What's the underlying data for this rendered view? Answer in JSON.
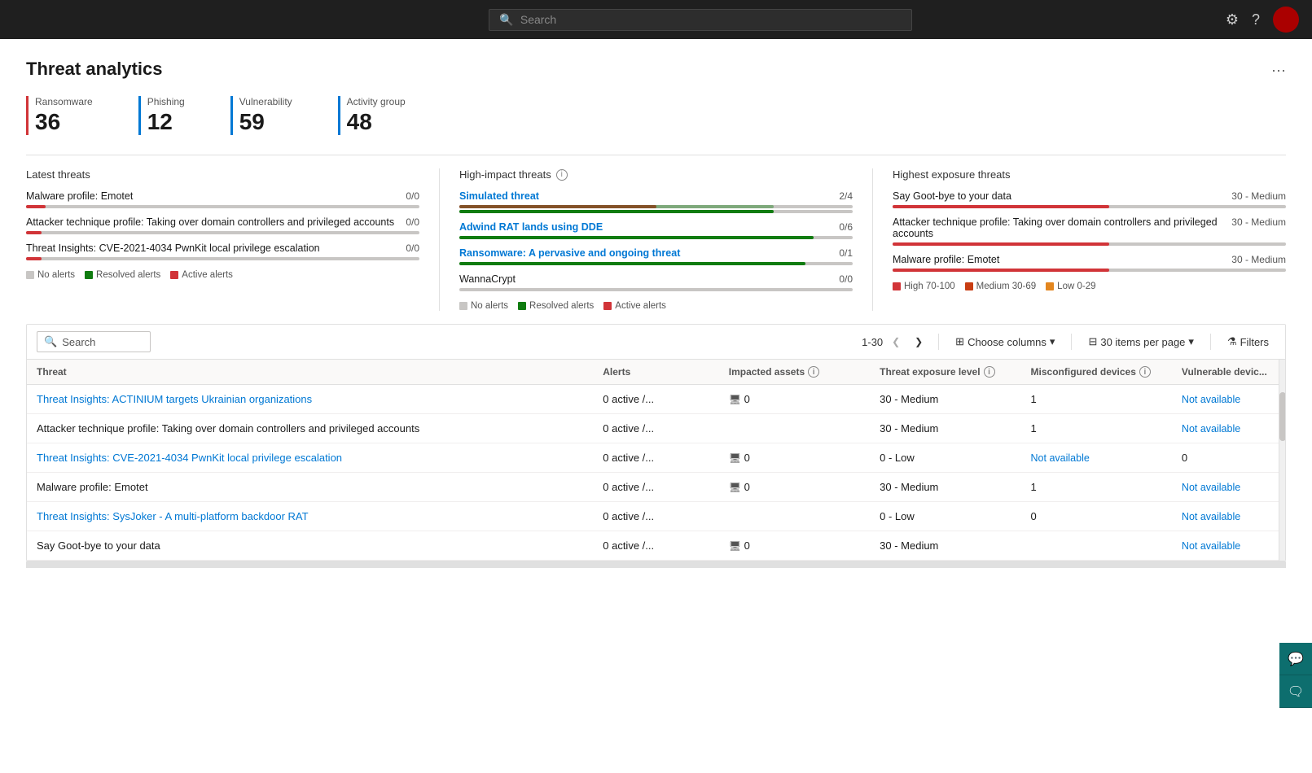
{
  "topbar": {
    "search_placeholder": "Search",
    "settings_icon": "⚙",
    "help_icon": "?"
  },
  "page": {
    "title": "Threat analytics"
  },
  "stats": [
    {
      "id": "ransomware",
      "label": "Ransomware",
      "value": "36",
      "color": "red"
    },
    {
      "id": "phishing",
      "label": "Phishing",
      "value": "12",
      "color": "blue"
    },
    {
      "id": "vulnerability",
      "label": "Vulnerability",
      "value": "59",
      "color": "blue2"
    },
    {
      "id": "activity",
      "label": "Activity group",
      "value": "48",
      "color": "blue3"
    }
  ],
  "latest_threats": {
    "title": "Latest threats",
    "items": [
      {
        "name": "Malware profile: Emotet",
        "score": "0/0",
        "red_pct": 5,
        "green_pct": 0
      },
      {
        "name": "Attacker technique profile: Taking over domain controllers and privileged accounts",
        "score": "0/0",
        "red_pct": 4,
        "green_pct": 0
      },
      {
        "name": "Threat Insights: CVE-2021-4034 PwnKit local privilege escalation",
        "score": "0/0",
        "red_pct": 4,
        "green_pct": 0
      }
    ],
    "legend": [
      {
        "color": "#c8c6c4",
        "label": "No alerts"
      },
      {
        "color": "#107c10",
        "label": "Resolved alerts"
      },
      {
        "color": "#d13438",
        "label": "Active alerts"
      }
    ]
  },
  "high_impact": {
    "title": "High-impact threats",
    "items": [
      {
        "name": "Simulated threat",
        "score": "2/4",
        "red_pct": 50,
        "green_pct": 80
      },
      {
        "name": "Adwind RAT lands using DDE",
        "score": "0/6",
        "red_pct": 0,
        "green_pct": 90
      },
      {
        "name": "Ransomware: A pervasive and ongoing threat",
        "score": "0/1",
        "red_pct": 0,
        "green_pct": 88
      },
      {
        "name": "WannaCrypt",
        "score": "0/0",
        "red_pct": 0,
        "green_pct": 0
      }
    ],
    "legend": [
      {
        "color": "#c8c6c4",
        "label": "No alerts"
      },
      {
        "color": "#107c10",
        "label": "Resolved alerts"
      },
      {
        "color": "#d13438",
        "label": "Active alerts"
      }
    ]
  },
  "highest_exposure": {
    "title": "Highest exposure threats",
    "items": [
      {
        "name": "Say Goot-bye to your data",
        "score": "30 - Medium",
        "red_pct": 55,
        "green_pct": 0
      },
      {
        "name": "Attacker technique profile: Taking over domain controllers and privileged accounts",
        "score": "30 - Medium",
        "red_pct": 55,
        "green_pct": 0
      },
      {
        "name": "Malware profile: Emotet",
        "score": "30 - Medium",
        "red_pct": 55,
        "green_pct": 0
      }
    ],
    "legend": [
      {
        "color": "#d13438",
        "label": "High 70-100"
      },
      {
        "color": "#c83d12",
        "label": "Medium 30-69"
      },
      {
        "color": "#e3861f",
        "label": "Low 0-29"
      }
    ]
  },
  "table": {
    "search_placeholder": "Search",
    "pagination": "1-30",
    "items_per_page": "30 items per page",
    "choose_columns": "Choose columns",
    "filters": "Filters",
    "columns": [
      "Threat",
      "Alerts",
      "Impacted assets",
      "Threat exposure level",
      "Misconfigured devices",
      "Vulnerable devic..."
    ],
    "rows": [
      {
        "threat": "Threat Insights: ACTINIUM targets Ukrainian organizations",
        "alerts": "0 active /...",
        "impacted": "0",
        "exposure": "30 - Medium",
        "misconfig": "1",
        "vuln": "Not available",
        "link": true
      },
      {
        "threat": "Attacker technique profile: Taking over domain controllers and privileged accounts",
        "alerts": "0 active /...",
        "impacted": "",
        "exposure": "30 - Medium",
        "misconfig": "1",
        "vuln": "Not available",
        "link": false
      },
      {
        "threat": "Threat Insights: CVE-2021-4034 PwnKit local privilege escalation",
        "alerts": "0 active /...",
        "impacted": "0",
        "exposure": "0 - Low",
        "misconfig": "Not available",
        "vuln": "0",
        "link": true
      },
      {
        "threat": "Malware profile: Emotet",
        "alerts": "0 active /...",
        "impacted": "0",
        "exposure": "30 - Medium",
        "misconfig": "1",
        "vuln": "Not available",
        "link": false
      },
      {
        "threat": "Threat Insights: SysJoker - A multi-platform backdoor RAT",
        "alerts": "0 active /...",
        "impacted": "",
        "exposure": "0 - Low",
        "misconfig": "0",
        "vuln": "Not available",
        "link": true
      },
      {
        "threat": "Say Goot-bye to your data",
        "alerts": "0 active /...",
        "impacted": "0",
        "exposure": "30 - Medium",
        "misconfig": "",
        "vuln": "Not available",
        "link": false
      }
    ]
  }
}
